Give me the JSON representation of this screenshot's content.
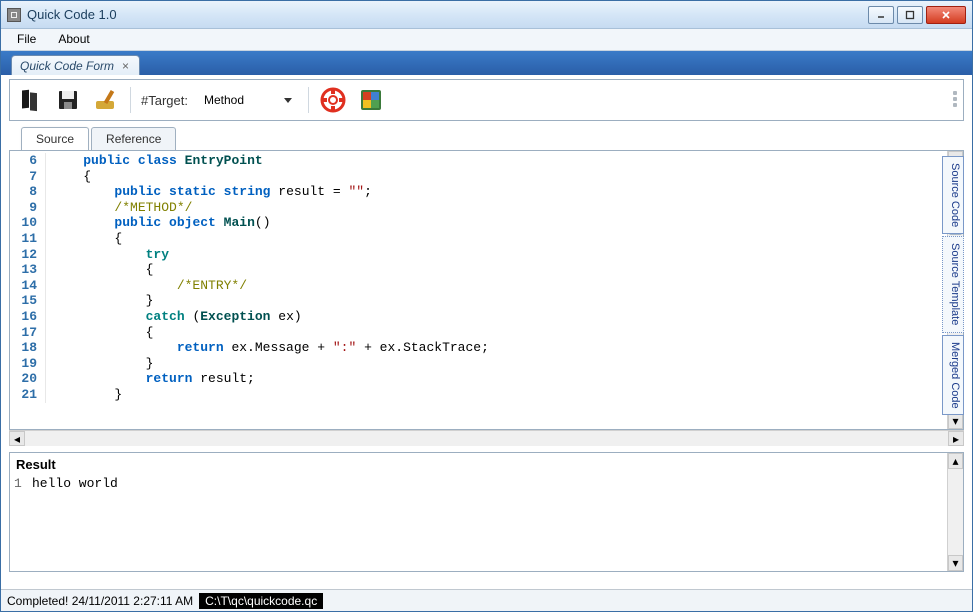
{
  "app": {
    "title": "Quick Code 1.0"
  },
  "menu": {
    "file": "File",
    "about": "About"
  },
  "docTab": {
    "label": "Quick Code Form"
  },
  "toolbar": {
    "target_label": "#Target:",
    "target_value": "Method"
  },
  "innerTabs": {
    "source": "Source",
    "reference": "Reference"
  },
  "sideTabs": {
    "sourceCode": "Source Code",
    "sourceTemplate": "Source Template",
    "mergedCode": "Merged Code"
  },
  "code": {
    "lines": [
      {
        "n": 6,
        "html": "    <span class='kw'>public</span> <span class='kw'>class</span> <span class='cls'>EntryPoint</span>"
      },
      {
        "n": 7,
        "html": "    {"
      },
      {
        "n": 8,
        "html": "        <span class='kw'>public</span> <span class='kw'>static</span> <span class='kw'>string</span> result = <span class='str'>\"\"</span>;"
      },
      {
        "n": 9,
        "html": "        <span class='cmt'>/*METHOD*/</span>"
      },
      {
        "n": 10,
        "html": "        <span class='kw'>public</span> <span class='kw'>object</span> <span class='cls'>Main</span>()"
      },
      {
        "n": 11,
        "html": "        {"
      },
      {
        "n": 12,
        "html": "            <span class='kw2'>try</span>"
      },
      {
        "n": 13,
        "html": "            {"
      },
      {
        "n": 14,
        "html": "                <span class='cmt'>/*ENTRY*/</span>"
      },
      {
        "n": 15,
        "html": "            }"
      },
      {
        "n": 16,
        "html": "            <span class='kw2'>catch</span> (<span class='cls'>Exception</span> ex)"
      },
      {
        "n": 17,
        "html": "            {"
      },
      {
        "n": 18,
        "html": "                <span class='kw'>return</span> ex.Message + <span class='str'>\":\"</span> + ex.StackTrace;"
      },
      {
        "n": 19,
        "html": "            }"
      },
      {
        "n": 20,
        "html": "            <span class='kw'>return</span> result;"
      },
      {
        "n": 21,
        "html": "        }"
      }
    ]
  },
  "result": {
    "title": "Result",
    "lines": [
      {
        "n": 1,
        "text": "hello world"
      }
    ]
  },
  "status": {
    "completed": "Completed! 24/11/2011 2:27:11 AM",
    "path": "C:\\T\\qc\\quickcode.qc"
  }
}
